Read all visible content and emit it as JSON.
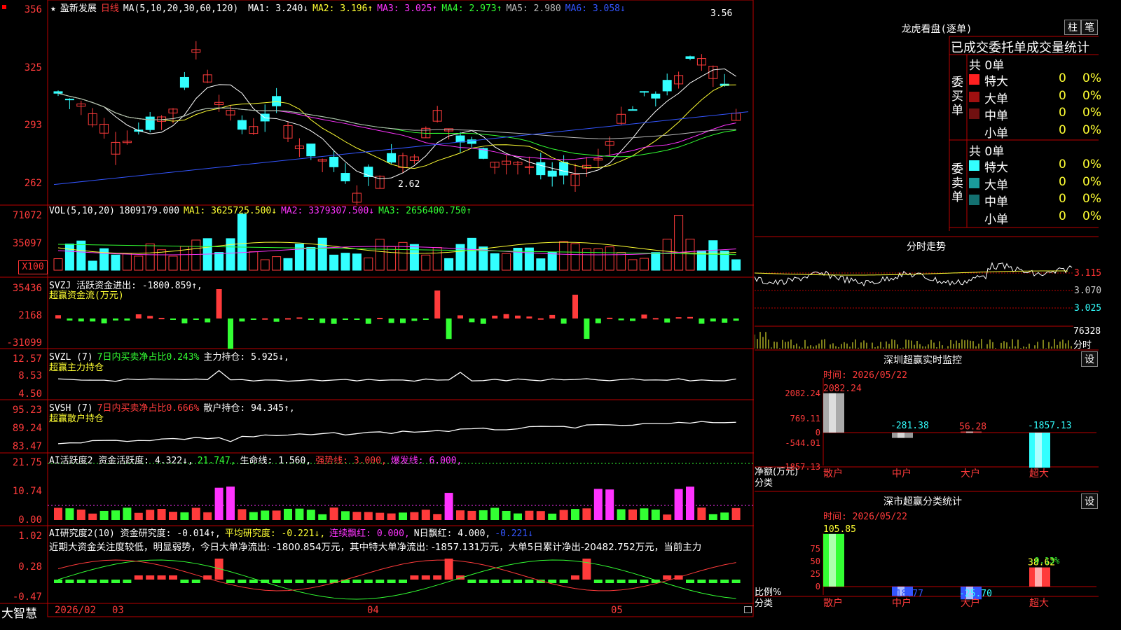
{
  "main": {
    "title": "盈新发展",
    "period": "日线",
    "ma_text": "MA(5,10,20,30,60,120)",
    "ma_values": [
      {
        "label": "MA1:",
        "value": "3.240",
        "arrow": "↓",
        "color": "#ffffff"
      },
      {
        "label": "MA2:",
        "value": "3.196",
        "arrow": "↑",
        "color": "#ffff33"
      },
      {
        "label": "MA3:",
        "value": "3.025",
        "arrow": "↑",
        "color": "#ff33ff"
      },
      {
        "label": "MA4:",
        "value": "2.973",
        "arrow": "↑",
        "color": "#33ff33"
      },
      {
        "label": "MA5:",
        "value": "2.980",
        "arrow": "",
        "color": "#bbbbbb"
      },
      {
        "label": "MA6:",
        "value": "3.058",
        "arrow": "↓",
        "color": "#3355ff"
      }
    ],
    "y_ticks": [
      "356",
      "325",
      "293",
      "262"
    ],
    "high_mark": "3.56",
    "low_mark": "2.62",
    "x_ticks": [
      "2026/02",
      "03",
      "04",
      "05"
    ],
    "brand": "大智慧",
    "vol_unit": "X100"
  },
  "vol": {
    "label": "VOL(5,10,20)",
    "value": "1809179.000",
    "value_arrow": "↓",
    "ma1": "MA1: 3625725.500↓",
    "ma2": "MA2: 3379307.500↓",
    "ma3": "MA3: 2656400.750↑",
    "y_ticks": [
      "71072",
      "35097"
    ]
  },
  "svzj": {
    "label": "SVZJ  活跃资金进出: -1800.859↑,",
    "sub": "超赢资金流(万元)",
    "y_ticks": [
      "35436",
      "2168",
      "-31099"
    ]
  },
  "svzl": {
    "label": "SVZL (7)",
    "ratio": "7日内买卖净占比0.243%",
    "hold": "主力持仓: 5.925↓,",
    "sub": "超赢主力持仓",
    "y_ticks": [
      "12.57",
      "8.53",
      "4.50"
    ]
  },
  "svsh": {
    "label": "SVSH (7)",
    "ratio": "7日内买卖净占比0.666%",
    "hold": "散户持仓: 94.345↑,",
    "sub": "超赢散户持仓",
    "y_ticks": [
      "95.23",
      "89.24",
      "83.47"
    ]
  },
  "ai2": {
    "label": "AI活跃度2 资金活跃度: 4.322↓,",
    "v2": "21.747,",
    "life": "生命线: 1.560,",
    "strong": "强势线: 3.000,",
    "burst": "爆发线: 6.000,",
    "y_ticks": [
      "21.75",
      "10.74",
      "0.00"
    ]
  },
  "ai_research": {
    "label": "AI研究度2(10) 资金研究度: -0.014↑,",
    "avg": "平均研究度: -0.221↓,",
    "cont": "连续飘红: 0.000,",
    "nday": "N日飘红: 4.000,",
    "last": "-0.221↓",
    "comment": "近期大资金关注度较低，明显弱势，今日大单净流出: -1800.854万元，其中特大单净流出: -1857.131万元，大单5日累计净出-20482.752万元，当前主力",
    "y_ticks": [
      "1.02",
      "0.28",
      "-0.47"
    ]
  },
  "dragon": {
    "title": "龙虎看盘(逐单)",
    "btn1": "柱",
    "btn2": "笔",
    "header": "已成交委托单成交量统计",
    "buy_label": "委买单",
    "sell_label": "委卖单",
    "buy_total": "共 0单",
    "sell_total": "共 0单",
    "buy_rows": [
      {
        "name": "特大",
        "count": "0",
        "pct": "0%",
        "color": "#ff2020"
      },
      {
        "name": "大单",
        "count": "0",
        "pct": "0%",
        "color": "#a01010"
      },
      {
        "name": "中单",
        "count": "0",
        "pct": "0%",
        "color": "#701010"
      },
      {
        "name": "小单",
        "count": "0",
        "pct": "0%",
        "color": "#000000"
      }
    ],
    "sell_rows": [
      {
        "name": "特大",
        "count": "0",
        "pct": "0%",
        "color": "#33ffff"
      },
      {
        "name": "大单",
        "count": "0",
        "pct": "0%",
        "color": "#1a9a9a"
      },
      {
        "name": "中单",
        "count": "0",
        "pct": "0%",
        "color": "#137070"
      },
      {
        "name": "小单",
        "count": "0",
        "pct": "0%",
        "color": "#000000"
      }
    ]
  },
  "intraday": {
    "title": "分时走势",
    "y_ticks": [
      "3.115",
      "3.070",
      "3.025"
    ],
    "vol_tick": "76328",
    "unit": "分时"
  },
  "sz_monitor": {
    "title": "深圳超赢实时监控",
    "settings": "设",
    "time": "时间: 2026/05/22",
    "y_ticks": [
      "2082.24",
      "769.11",
      "0",
      "-544.01",
      "-1857.13"
    ],
    "unit_label": "净额(万元)",
    "cat_label": "分类",
    "categories": [
      "散户",
      "中户",
      "大户",
      "超大"
    ],
    "values": [
      "2082.24",
      "-281.38",
      "56.28",
      "-1857.13"
    ]
  },
  "sz_class": {
    "title": "深市超赢分类统计",
    "settings": "设",
    "time": "时间: 2026/05/22",
    "y_ticks": [
      "75",
      "50",
      "25",
      "0"
    ],
    "unit_label": "比例%",
    "cat_label": "分类",
    "categories": [
      "散户",
      "中户",
      "大户",
      "超大"
    ],
    "values": [
      "105.85",
      "-18.77",
      "-25.70",
      "38.62"
    ],
    "extra": "-0.13%"
  },
  "chart_data": [
    {
      "type": "bar",
      "title": "深圳超赢实时监控",
      "ylabel": "净额(万元)",
      "categories": [
        "散户",
        "中户",
        "大户",
        "超大"
      ],
      "values": [
        2082.24,
        -281.38,
        56.28,
        -1857.13
      ],
      "ylim": [
        -1857.13,
        2082.24
      ]
    },
    {
      "type": "bar",
      "title": "深市超赢分类统计",
      "ylabel": "比例%",
      "categories": [
        "散户",
        "中户",
        "大户",
        "超大"
      ],
      "values": [
        105.85,
        -18.77,
        -25.7,
        38.62
      ],
      "ylim": [
        0,
        75
      ]
    }
  ]
}
